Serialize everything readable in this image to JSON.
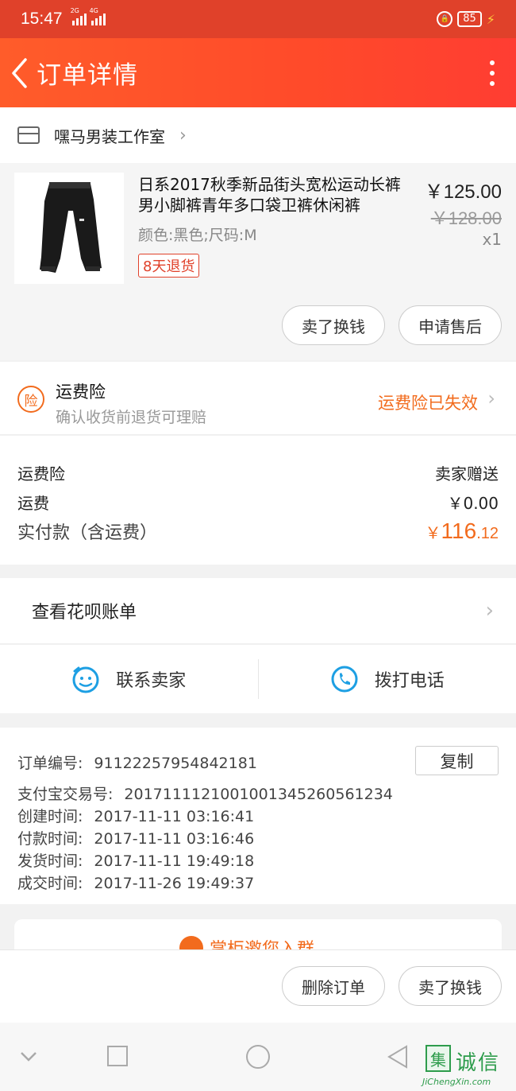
{
  "status_bar": {
    "time": "15:47",
    "net1": "2G",
    "net2": "4G",
    "battery": "85"
  },
  "nav": {
    "title": "订单详情"
  },
  "shop": {
    "name": "嘿马男装工作室"
  },
  "product": {
    "title": "日系2017秋季新品街头宽松运动长裤男小脚裤青年多口袋卫裤休闲裤",
    "sku": "颜色:黑色;尺码:M",
    "return_tag": "8天退货",
    "price": "￥125.00",
    "original_price": "￥128.00",
    "quantity": "x1",
    "sell_exchange_label": "卖了换钱",
    "after_sale_label": "申请售后"
  },
  "insurance": {
    "badge": "险",
    "title": "运费险",
    "subtitle": "确认收货前退货可理赔",
    "status": "运费险已失效"
  },
  "costs": {
    "insurance_label": "运费险",
    "insurance_value": "卖家赠送",
    "shipping_label": "运费",
    "shipping_value": "￥0.00",
    "paid_label": "实付款（含运费）",
    "paid_currency": "￥",
    "paid_int": "116",
    "paid_dec": ".12"
  },
  "huabei": {
    "label": "查看花呗账单"
  },
  "contact": {
    "seller_label": "联系卖家",
    "phone_label": "拨打电话"
  },
  "order_info": {
    "order_no_label": "订单编号:",
    "order_no": "91122257954842181",
    "copy_label": "复制",
    "alipay_label": "支付宝交易号:",
    "alipay_no": "2017111121001001345260561234",
    "created_label": "创建时间:",
    "created": "2017-11-11 03:16:41",
    "paid_label": "付款时间:",
    "paid": "2017-11-11 03:16:46",
    "shipped_label": "发货时间:",
    "shipped": "2017-11-11 19:49:18",
    "done_label": "成交时间:",
    "done": "2017-11-26 19:49:37"
  },
  "promo": {
    "text": "掌柜邀您入群"
  },
  "bottom_actions": {
    "delete_label": "删除订单",
    "sell_label": "卖了换钱"
  },
  "watermark": {
    "char": "集",
    "cn": "诚信",
    "en": "JiChengXin.com"
  },
  "colors": {
    "brand": "#ff5022",
    "accent_orange": "#f26b1d",
    "watermark_green": "#2e9c4c"
  }
}
